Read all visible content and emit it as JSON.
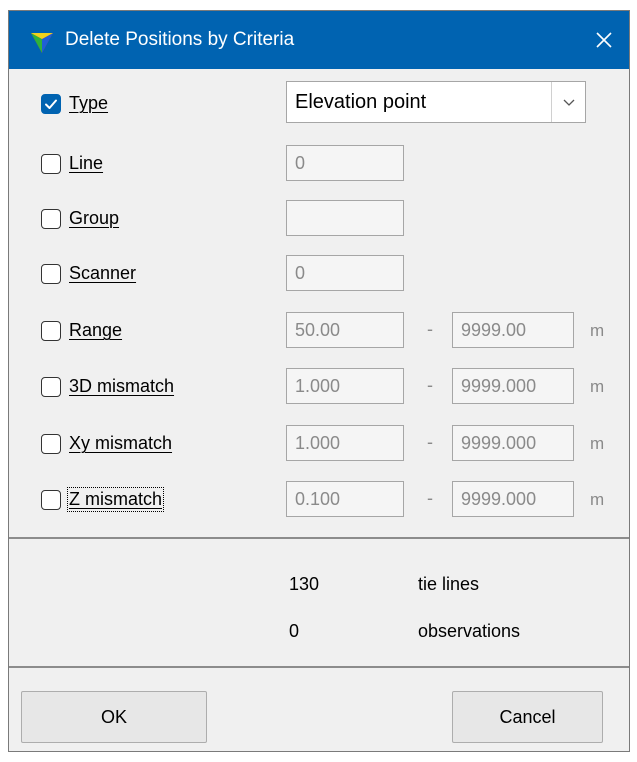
{
  "window": {
    "title": "Delete Positions by Criteria",
    "close_glyph": "✕"
  },
  "criteria": [
    {
      "label": "Type",
      "checked": true,
      "kind": "select",
      "value": "Elevation point"
    },
    {
      "label": "Line",
      "checked": false,
      "kind": "single",
      "value": "0"
    },
    {
      "label": "Group",
      "checked": false,
      "kind": "single",
      "value": ""
    },
    {
      "label": "Scanner",
      "checked": false,
      "kind": "single",
      "value": "0"
    },
    {
      "label": "Range",
      "checked": false,
      "kind": "range",
      "min": "50.00",
      "max": "9999.00",
      "unit": "m"
    },
    {
      "label": "3D mismatch",
      "checked": false,
      "kind": "range",
      "min": "1.000",
      "max": "9999.000",
      "unit": "m"
    },
    {
      "label": "Xy mismatch",
      "checked": false,
      "kind": "range",
      "min": "1.000",
      "max": "9999.000",
      "unit": "m"
    },
    {
      "label": "Z mismatch",
      "checked": false,
      "kind": "range",
      "min": "0.100",
      "max": "9999.000",
      "unit": "m"
    }
  ],
  "range_separator": "-",
  "stats": [
    {
      "count": "130",
      "label": "tie lines"
    },
    {
      "count": "0",
      "label": "observations"
    }
  ],
  "buttons": {
    "ok": "OK",
    "cancel": "Cancel"
  },
  "colors": {
    "title_bar": "#0063b1",
    "checkbox_checked": "#0063b1"
  }
}
